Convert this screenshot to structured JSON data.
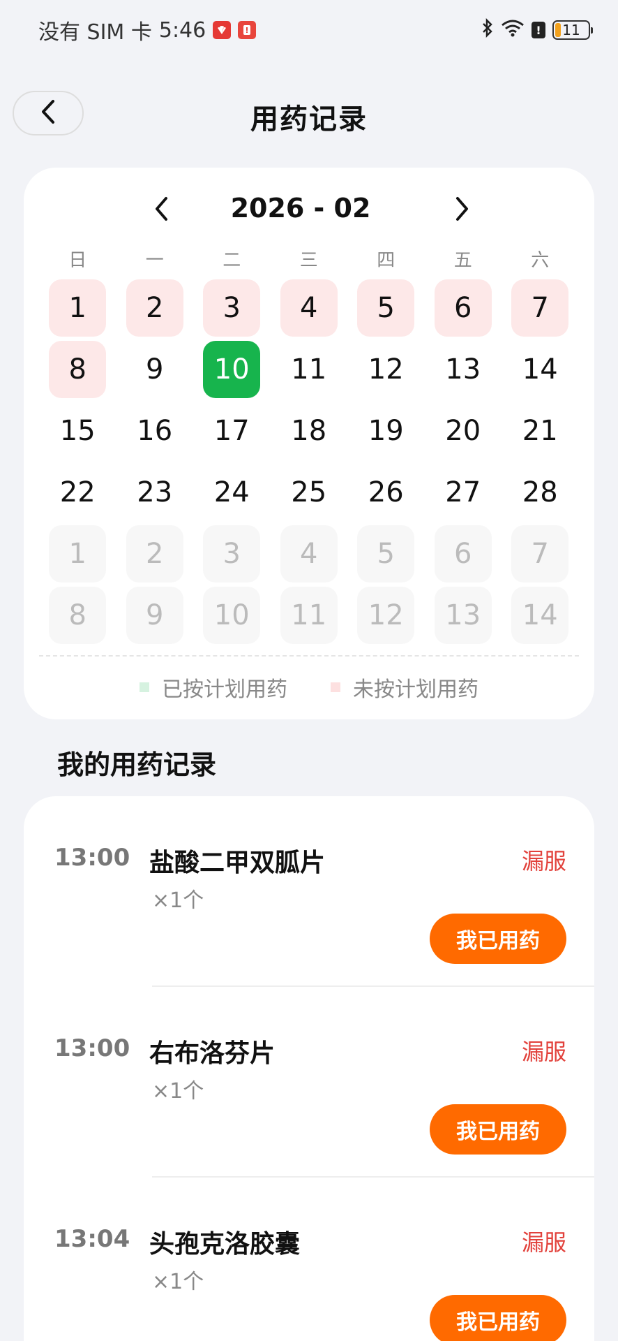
{
  "status_bar": {
    "carrier": "没有 SIM 卡",
    "time": "5:46",
    "battery": "11"
  },
  "header": {
    "title": "用药记录"
  },
  "calendar": {
    "month": "2026 - 02",
    "weekdays": [
      "日",
      "一",
      "二",
      "三",
      "四",
      "五",
      "六"
    ],
    "days": [
      {
        "label": "1",
        "state": "missed"
      },
      {
        "label": "2",
        "state": "missed"
      },
      {
        "label": "3",
        "state": "missed"
      },
      {
        "label": "4",
        "state": "missed"
      },
      {
        "label": "5",
        "state": "missed"
      },
      {
        "label": "6",
        "state": "missed"
      },
      {
        "label": "7",
        "state": "missed"
      },
      {
        "label": "8",
        "state": "missed"
      },
      {
        "label": "9",
        "state": "normal"
      },
      {
        "label": "10",
        "state": "today"
      },
      {
        "label": "11",
        "state": "normal"
      },
      {
        "label": "12",
        "state": "normal"
      },
      {
        "label": "13",
        "state": "normal"
      },
      {
        "label": "14",
        "state": "normal"
      },
      {
        "label": "15",
        "state": "normal"
      },
      {
        "label": "16",
        "state": "normal"
      },
      {
        "label": "17",
        "state": "normal"
      },
      {
        "label": "18",
        "state": "normal"
      },
      {
        "label": "19",
        "state": "normal"
      },
      {
        "label": "20",
        "state": "normal"
      },
      {
        "label": "21",
        "state": "normal"
      },
      {
        "label": "22",
        "state": "normal"
      },
      {
        "label": "23",
        "state": "normal"
      },
      {
        "label": "24",
        "state": "normal"
      },
      {
        "label": "25",
        "state": "normal"
      },
      {
        "label": "26",
        "state": "normal"
      },
      {
        "label": "27",
        "state": "normal"
      },
      {
        "label": "28",
        "state": "normal"
      },
      {
        "label": "1",
        "state": "next-month"
      },
      {
        "label": "2",
        "state": "next-month"
      },
      {
        "label": "3",
        "state": "next-month"
      },
      {
        "label": "4",
        "state": "next-month"
      },
      {
        "label": "5",
        "state": "next-month"
      },
      {
        "label": "6",
        "state": "next-month"
      },
      {
        "label": "7",
        "state": "next-month"
      },
      {
        "label": "8",
        "state": "next-month"
      },
      {
        "label": "9",
        "state": "next-month"
      },
      {
        "label": "10",
        "state": "next-month"
      },
      {
        "label": "11",
        "state": "next-month"
      },
      {
        "label": "12",
        "state": "next-month"
      },
      {
        "label": "13",
        "state": "next-month"
      },
      {
        "label": "14",
        "state": "next-month"
      }
    ],
    "legend": {
      "taken_label": "已按计划用药",
      "taken_color": "#d6f2e0",
      "missed_label": "未按计划用药",
      "missed_color": "#fde0e0"
    }
  },
  "records": {
    "title": "我的用药记录",
    "items": [
      {
        "time": "13:00",
        "name": "盐酸二甲双胍片",
        "qty": "×1个",
        "status": "漏服",
        "action": "我已用药"
      },
      {
        "time": "13:00",
        "name": "右布洛芬片",
        "qty": "×1个",
        "status": "漏服",
        "action": "我已用药"
      },
      {
        "time": "13:04",
        "name": "头孢克洛胶囊",
        "qty": "×1个",
        "status": "漏服",
        "action": "我已用药"
      }
    ]
  },
  "colors": {
    "accent_orange": "#ff6a00",
    "today_green": "#17b44d",
    "missed_red": "#e2413b"
  },
  "icons": [
    "back-arrow-icon",
    "chevron-left-icon",
    "chevron-right-icon",
    "bluetooth-icon",
    "wifi-icon",
    "battery-icon"
  ]
}
